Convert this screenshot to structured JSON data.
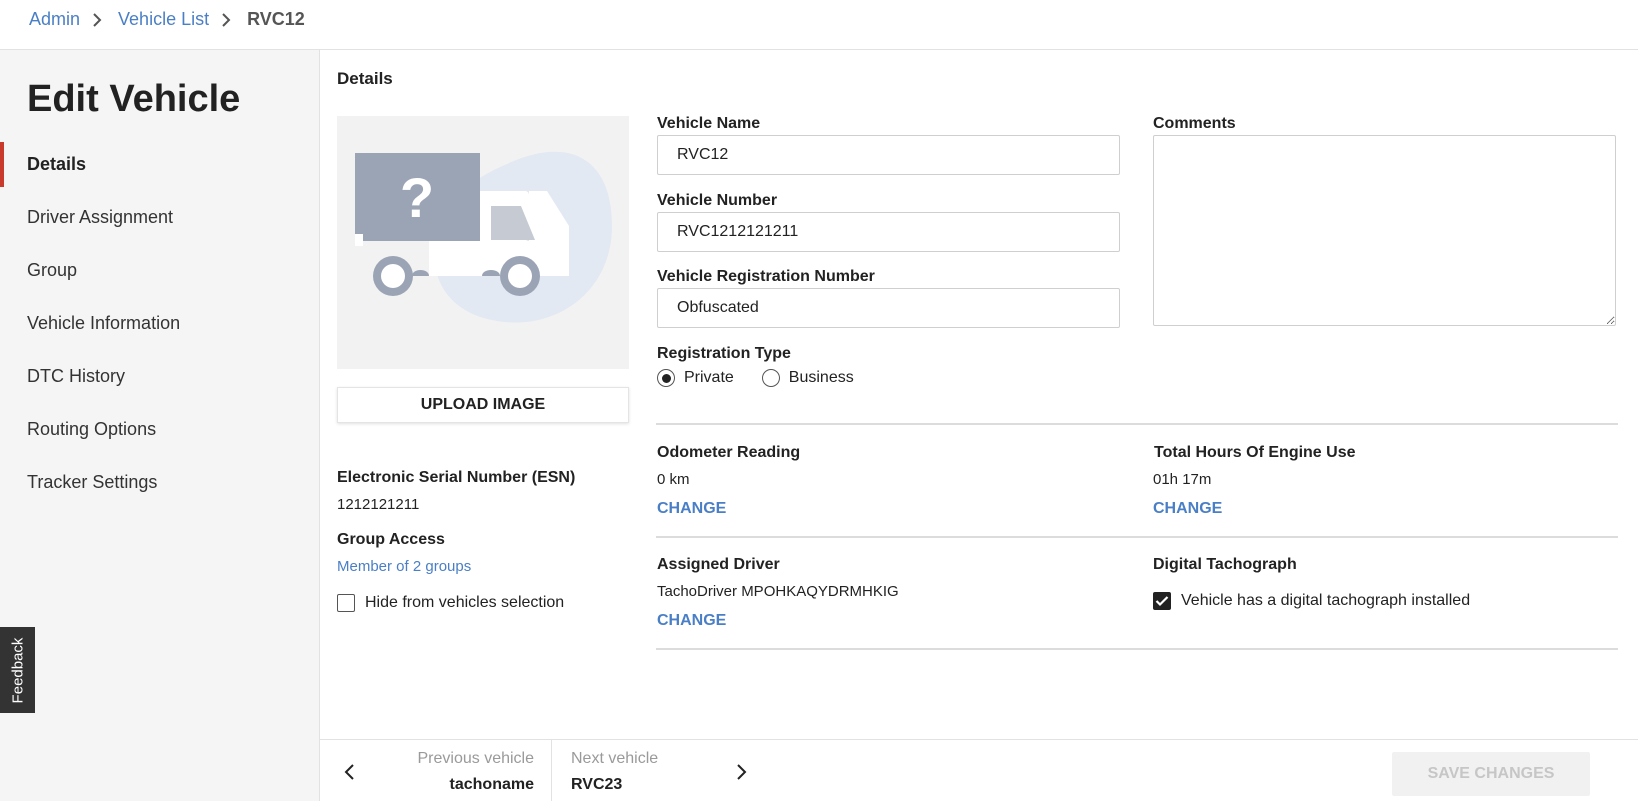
{
  "breadcrumb": {
    "items": [
      "Admin",
      "Vehicle List"
    ],
    "current": "RVC12"
  },
  "sidebar": {
    "title": "Edit Vehicle",
    "items": [
      {
        "label": "Details",
        "active": true
      },
      {
        "label": "Driver Assignment",
        "active": false
      },
      {
        "label": "Group",
        "active": false
      },
      {
        "label": "Vehicle Information",
        "active": false
      },
      {
        "label": "DTC History",
        "active": false
      },
      {
        "label": "Routing Options",
        "active": false
      },
      {
        "label": "Tracker Settings",
        "active": false
      }
    ]
  },
  "feedback": {
    "label": "Feedback"
  },
  "details": {
    "section_title": "Details",
    "image_icon": "truck-unknown-icon",
    "upload_label": "UPLOAD IMAGE",
    "esn": {
      "label": "Electronic Serial Number (ESN)",
      "value": "1212121211"
    },
    "group_access": {
      "label": "Group Access",
      "link": "Member of 2 groups"
    },
    "hide_checkbox": {
      "label": "Hide from vehicles selection",
      "checked": false
    },
    "vehicle_name": {
      "label": "Vehicle Name",
      "value": "RVC12"
    },
    "vehicle_number": {
      "label": "Vehicle Number",
      "value": "RVC1212121211"
    },
    "registration_number": {
      "label": "Vehicle Registration Number",
      "value": "Obfuscated"
    },
    "registration_type": {
      "label": "Registration Type",
      "options": [
        {
          "label": "Private",
          "checked": true
        },
        {
          "label": "Business",
          "checked": false
        }
      ]
    },
    "comments": {
      "label": "Comments",
      "value": ""
    },
    "odometer": {
      "label": "Odometer Reading",
      "value": "0 km",
      "change": "CHANGE"
    },
    "engine_hours": {
      "label": "Total Hours Of Engine Use",
      "value": "01h 17m",
      "change": "CHANGE"
    },
    "assigned_driver": {
      "label": "Assigned Driver",
      "value": "TachoDriver MPOHKAQYDRMHKIG",
      "change": "CHANGE"
    },
    "tachograph": {
      "label": "Digital Tachograph",
      "checkbox_label": "Vehicle has a digital tachograph installed",
      "checked": true
    }
  },
  "footer": {
    "prev_caption": "Previous vehicle",
    "prev_name": "tachoname",
    "next_caption": "Next vehicle",
    "next_name": "RVC23",
    "save_label": "SAVE CHANGES"
  },
  "colors": {
    "accent": "#4a7fc6",
    "active_indicator": "#c93a2c",
    "sidebar_bg": "#f5f5f5"
  }
}
